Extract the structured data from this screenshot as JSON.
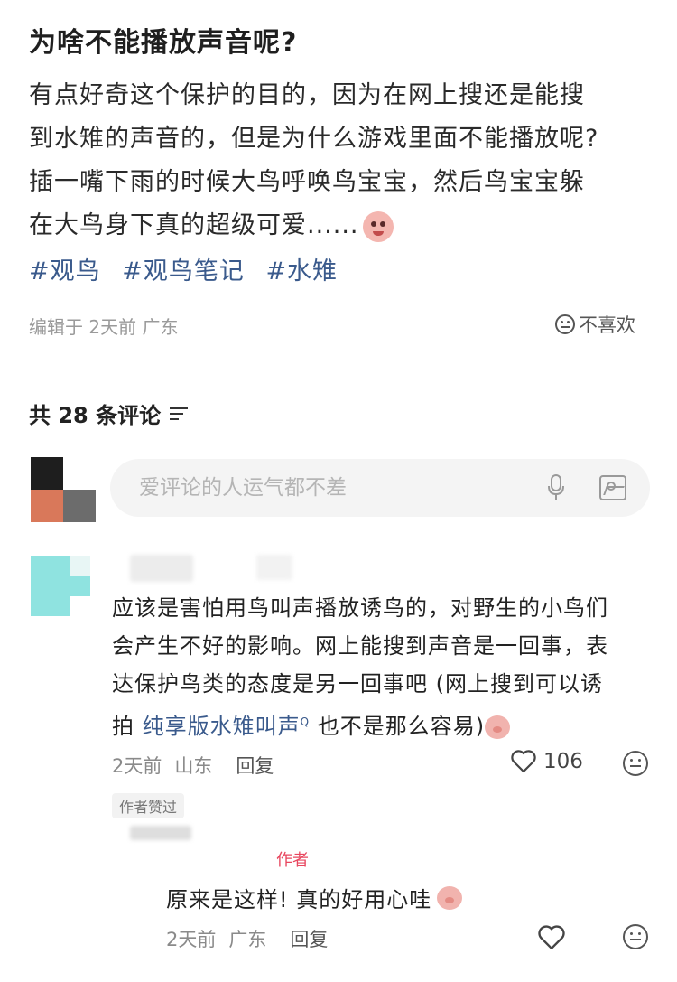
{
  "post": {
    "title": "为啥不能播放声音呢?",
    "body_line1": "有点好奇这个保护的目的，因为在网上搜还是能搜",
    "body_line2": "到水雉的声音的，但是为什么游戏里面不能播放呢?",
    "body_line3": "插一嘴下雨的时候大鸟呼唤鸟宝宝，然后鸟宝宝躲",
    "body_line4": "在大鸟身下真的超级可爱......",
    "tags": [
      "#观鸟",
      "#观鸟笔记",
      "#水雉"
    ],
    "meta": "编辑于 2天前 广东",
    "dislike_label": "不喜欢"
  },
  "comments_header": {
    "count_label": "共 28 条评论"
  },
  "comment_input": {
    "placeholder": "爱评论的人运气都不差"
  },
  "comment1": {
    "line1": "应该是害怕用鸟叫声播放诱鸟的，对野生的小鸟们",
    "line2": "会产生不好的影响。网上能搜到声音是一回事，表",
    "line3": "达保护鸟类的态度是另一回事吧 (网上搜到可以诱",
    "line4_prefix": "拍",
    "search_link": "纯享版水雉叫声",
    "line4_suffix": "也不是那么容易)",
    "time": "2天前",
    "location": "山东",
    "reply_label": "回复",
    "likes": "106",
    "author_liked": "作者赞过"
  },
  "reply1": {
    "badge": "作者",
    "text": "原来是这样! 真的好用心哇",
    "time": "2天前",
    "location": "广东",
    "reply_label": "回复"
  },
  "colors": {
    "link": "#3a5a8c",
    "author_badge": "#e8475f",
    "input_bg": "#f4f4f4"
  },
  "icons": [
    "smile-icon",
    "filter-icon",
    "mic-icon",
    "image-icon",
    "heart-icon",
    "face-icon"
  ]
}
